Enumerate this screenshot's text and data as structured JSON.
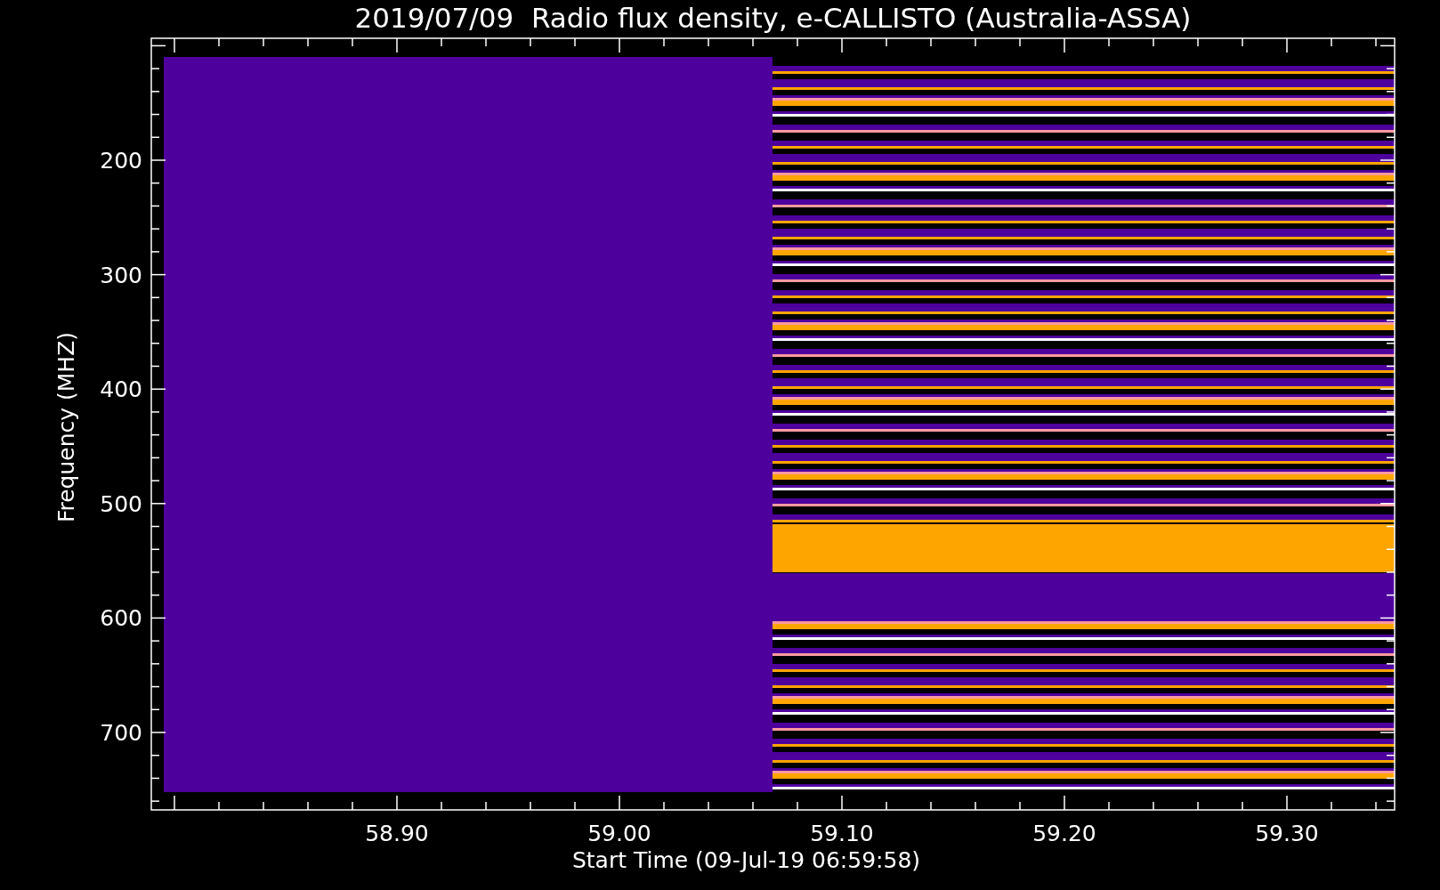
{
  "chart": {
    "title": "2019/07/09  Radio flux density, e-CALLISTO (Australia-ASSA)",
    "x_axis": {
      "label": "Start Time (09-Jul-19 06:59:58)",
      "ticks": [
        "58.90",
        "59.00",
        "59.10",
        "59.20",
        "59.30"
      ]
    },
    "y_axis": {
      "label": "Frequency (MHZ)",
      "ticks": [
        "200",
        "300",
        "400",
        "500",
        "600",
        "700"
      ]
    }
  }
}
